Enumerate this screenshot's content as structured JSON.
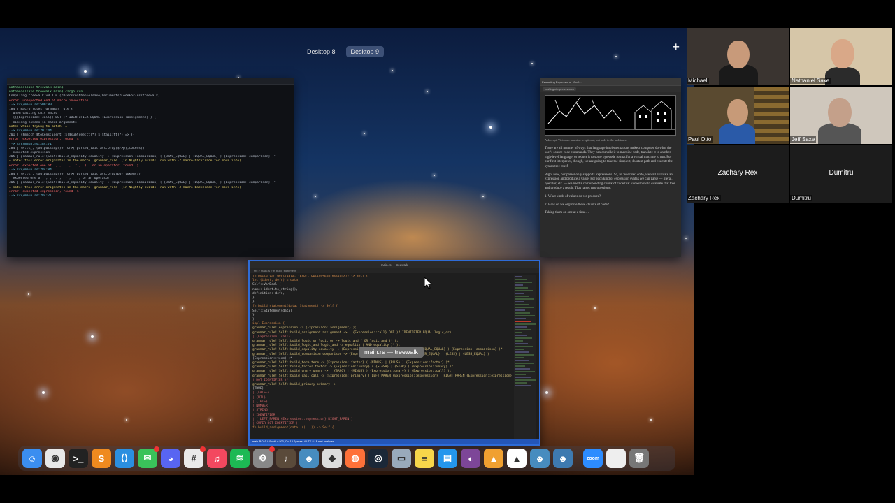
{
  "spaces": [
    "Desktop 8",
    "Desktop 9"
  ],
  "active_space": "Desktop 9",
  "add_space_label": "+",
  "terminal": {
    "lines": [
      "nathanielsaxe treewalk main$",
      "nathanielsaxe treewalk main$ cargo run",
      "   Compiling treewalk v0.1.0 (/Users/nathanielsaxe/Documents/CodeFor-rs/treewalk)",
      "error: unexpected end of macro invocation",
      "  --> src/main.rs:500:80",
      "",
      "184 | macro_rules! grammar_rule {",
      "    |                  when calling this macro",
      "",
      "    |         {{{Expression::call}} DOT }? IDENTIFIER EQUAL {Expression::assignment} } (",
      "    |                                               missing tokens in macro arguments",
      "",
      "note: while trying to match `=`",
      "  --> src/main.rs:201:44",
      "",
      "201 |     ($match $tokens:ident ($($subtree:tt)*) $($tail:tt)*) => {{",
      "",
      "error: expected expression, found `$`",
      "  --> src/main.rs:284:71",
      "",
      "284 |                 (N::<_, (outputsExpr)error>((parsed_tail.ast.prop($->p),tokens))",
      "    |                                                    expected expression",
      "",
      "305 |         grammar_rule!(Self::build_equality  equality -> {Expression::comparison} ( {BANG_EQUAL} | {EQUAL_EQUAL} ) {Expression::comparison} )*",
      "",
      "    = note: this error originates in the macro `grammar_rule` (in Nightly builds, run with -Z macro-backtrace for more info)",
      "",
      "error: expected one of `,`, `.`, `?`, `)`, or an operator, found `)`",
      "  --> src/main.rs:284:84",
      "",
      "284 |                 (N::<_, (outputsExpr)error>((parsed_tail.ast.prob(bo),tokens))",
      "    |                                              expected one of `,`, `.`, `?`, `)`, or an operator",
      "",
      "305 |         grammar_rule!(Self::build_equality  equality -> {Expression::comparison} ( {BANG_EQUAL} | {EQUAL_EQUAL} ) {Expression::comparison} )*",
      "",
      "    = note: this error originates in the macro `grammar_rule` (in Nightly builds, run with -Z macro-backtrace for more info)",
      "",
      "error: expected expression, found `$`",
      "  --> src/main.rs:284:71"
    ]
  },
  "browser": {
    "tab": "Evaluating Expressions · Craf…",
    "url": "craftinginterpreters.com",
    "caption": "A decrepit Victorian mansion is optional, but adds to the ambiance.",
    "paragraphs": [
      "There are all manner of ways that language implementations make a computer do what the user's source code commands. They can compile it to machine code, translate it to another high-level language, or reduce it to some bytecode format for a virtual machine to run. For our first interpreter, though, we are going to take the simplest, shortest path and execute the syntax tree itself.",
      "Right now, our parser only supports expressions. So, to \"execute\" code, we will evaluate an expression and produce a value. For each kind of expression syntax we can parse — literal, operator, etc. — we need a corresponding chunk of code that knows how to evaluate that tree and produce a result. That raises two questions:",
      "1. What kinds of values do we produce?",
      "2. How do we organize those chunks of code?",
      "Taking them on one at a time…"
    ]
  },
  "editor": {
    "title": "main.rs — treewalk",
    "breadcrumb": "src > main.rs > fn build_statement",
    "tooltip": "main.rs — treewalk",
    "status": "main  ⊗ 0 ⚠ 0   Rust   Ln 503, Col 18   Spaces: 4   UTF-8   LF   rust-analyzer",
    "lines": [
      "    fn build_var_decl(data: (Expr, Option<Expression>)) -> Self {",
      "        let (ident, defn) = data;",
      "        Self::VarDecl {",
      "            name: ident.to_string(),",
      "            definition: defn,",
      "        }",
      "    }",
      "",
      "    fn build_statement(data: Statement) -> Self {",
      "        Self::Statement(data)",
      "    }",
      "}",
      "",
      "impl Expression {",
      "    grammar_rule!(expression -> {Expression::assignment} );",
      "    grammar_rule!(Self::build_assignment  assignment -> ( {Expression::call} DOT )? IDENTIFIER EQUAL logic_or)",
      "        | {Expression::call} ...",
      "    grammar_rule!(Self::build_logic_or  logic_or -> logic_and ( OR logic_and )* );",
      "    grammar_rule!(Self::build_logic_and  logic_and -> equality ( AND equality )* );",
      "    grammar_rule!(Self::build_equality  equality -> {Expression::comparison} ( {BANG_EQUAL} | {EQUAL_EQUAL} ) {Expression::comparison} )*",
      "    grammar_rule!(Self::build_comparison  comparison -> {Expression::term} ( {GREATER} | {GREATER_EQUAL} | {LESS} | {LESS_EQUAL} )",
      "        {Expression::term} )*",
      "    grammar_rule!(Self::build_term  term -> {Expression::factor} ( {MINUS} | {PLUS} ) {Expression::factor} )*",
      "    grammar_rule!(Self::build_factor  factor -> {Expression::unary} ( {SLASH} | {STAR} ) {Expression::unary} )*",
      "    grammar_rule!(Self::build_unary  unary -> ( {BANG} | {MINUS} ) {Expression::unary} | {Expression::call} );",
      "    grammar_rule!(Self::build_call  call -> {Expression::primary} ( LEFT_PAREN {Expression::expression} ) RIGHT_PAREN {Expression::expression} )",
      "        | DOT IDENTIFIER )*",
      "    grammar_rule!(Self::build_primary  primary ->",
      "        {TRUE}",
      "        | {FALSE}",
      "        | {NIL}",
      "        | {THIS}",
      "        | NUMBER",
      "        | STRING",
      "        | IDENTIFIER",
      "        | ( LEFT_PAREN {Expression::expression} RIGHT_PAREN )",
      "        | SUPER DOT IDENTIFIER );",
      "    fn build_assignment(data: ((...)) -> Self {"
    ]
  },
  "dock": [
    {
      "name": "finder-icon",
      "glyph": "☺",
      "color": "#3b8ef0"
    },
    {
      "name": "chrome-icon",
      "glyph": "◉",
      "color": "#e8e8e8"
    },
    {
      "name": "terminal-icon",
      "glyph": ">_",
      "color": "#222"
    },
    {
      "name": "sublime-icon",
      "glyph": "S",
      "color": "#ef8a1f"
    },
    {
      "name": "vscode-icon",
      "glyph": "⟨⟩",
      "color": "#2b8fe0"
    },
    {
      "name": "messages-icon",
      "glyph": "✉",
      "color": "#3ac25a",
      "badge": true
    },
    {
      "name": "discord-icon",
      "glyph": "◕",
      "color": "#5865f2"
    },
    {
      "name": "slack-icon",
      "glyph": "#",
      "color": "#e9e9e9",
      "badge": true
    },
    {
      "name": "music-icon",
      "glyph": "♫",
      "color": "#f3485f"
    },
    {
      "name": "spotify-icon",
      "glyph": "≋",
      "color": "#1db954"
    },
    {
      "name": "system-preferences-icon",
      "glyph": "⚙",
      "color": "#888",
      "badge": true
    },
    {
      "name": "instruments-icon",
      "glyph": "♪",
      "color": "#5a4a3a"
    },
    {
      "name": "godot-icon",
      "glyph": "☻",
      "color": "#478cbf"
    },
    {
      "name": "unity-icon",
      "glyph": "◆",
      "color": "#ddd"
    },
    {
      "name": "firefox-icon",
      "glyph": "◍",
      "color": "#ff7139"
    },
    {
      "name": "steam-icon",
      "glyph": "◎",
      "color": "#1b2838"
    },
    {
      "name": "preview-icon",
      "glyph": "▭",
      "color": "#9ab"
    },
    {
      "name": "notes-icon",
      "glyph": "≡",
      "color": "#f7d54a"
    },
    {
      "name": "docker-icon",
      "glyph": "▤",
      "color": "#2496ed"
    },
    {
      "name": "tor-icon",
      "glyph": "◐",
      "color": "#7d4698"
    },
    {
      "name": "vlc-icon",
      "glyph": "▲",
      "color": "#f0a030"
    },
    {
      "name": "nordvpn-icon",
      "glyph": "▲",
      "color": "#ffffff"
    },
    {
      "name": "godot-2-icon",
      "glyph": "☻",
      "color": "#478cbf"
    },
    {
      "name": "godot-3-icon",
      "glyph": "☻",
      "color": "#3e7ab0"
    },
    {
      "name": "zoom-icon",
      "glyph": "zoom",
      "color": "#2d8cff"
    },
    {
      "name": "document-icon",
      "glyph": "",
      "color": "#eee"
    },
    {
      "name": "trash-icon",
      "glyph": "🗑",
      "color": "#777"
    }
  ],
  "participants": [
    {
      "name": "Michael",
      "video": true
    },
    {
      "name": "Nathaniel Saxe",
      "video": true
    },
    {
      "name": "Paul Otto",
      "video": true
    },
    {
      "name": "Jeff Saxe",
      "video": true
    },
    {
      "name": "Zachary Rex",
      "video": false
    },
    {
      "name": "Dumitru",
      "video": false
    }
  ]
}
